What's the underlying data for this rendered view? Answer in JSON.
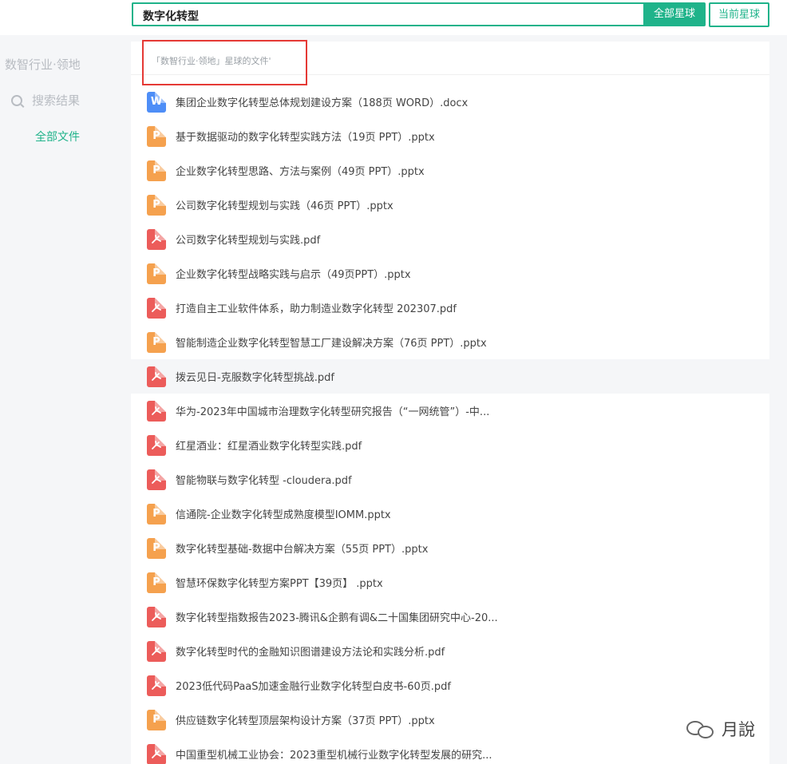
{
  "search": {
    "query": "数字化转型",
    "all_planets_label": "全部星球",
    "current_planet_label": "当前星球"
  },
  "sidebar": {
    "title": "数智行业·领地",
    "search_results_label": "搜索结果",
    "all_files_label": "全部文件"
  },
  "panel": {
    "title": "「数智行业·领地」星球的文件'"
  },
  "files": [
    {
      "type": "word",
      "icon_label": "W",
      "name": "集团企业数字化转型总体规划建设方案（188页 WORD）.docx"
    },
    {
      "type": "ppt",
      "icon_label": "P",
      "name": "基于数据驱动的数字化转型实践方法（19页 PPT）.pptx"
    },
    {
      "type": "ppt",
      "icon_label": "P",
      "name": "企业数字化转型思路、方法与案例（49页 PPT）.pptx"
    },
    {
      "type": "ppt",
      "icon_label": "P",
      "name": "公司数字化转型规划与实践（46页 PPT）.pptx"
    },
    {
      "type": "pdf",
      "icon_label": "",
      "name": "公司数字化转型规划与实践.pdf"
    },
    {
      "type": "ppt",
      "icon_label": "P",
      "name": "企业数字化转型战略实践与启示（49页PPT）.pptx"
    },
    {
      "type": "pdf",
      "icon_label": "",
      "name": "打造自主工业软件体系，助力制造业数字化转型 202307.pdf"
    },
    {
      "type": "ppt",
      "icon_label": "P",
      "name": "智能制造企业数字化转型智慧工厂建设解决方案（76页 PPT）.pptx"
    },
    {
      "type": "pdf",
      "icon_label": "",
      "name": "拨云见日-克服数字化转型挑战.pdf"
    },
    {
      "type": "pdf",
      "icon_label": "",
      "name": "华为-2023年中国城市治理数字化转型研究报告（“一网统管”）-中..."
    },
    {
      "type": "pdf",
      "icon_label": "",
      "name": "红星酒业：红星酒业数字化转型实践.pdf"
    },
    {
      "type": "pdf",
      "icon_label": "",
      "name": "智能物联与数字化转型 -cloudera.pdf"
    },
    {
      "type": "ppt",
      "icon_label": "P",
      "name": "信通院-企业数字化转型成熟度模型IOMM.pptx"
    },
    {
      "type": "ppt",
      "icon_label": "P",
      "name": "数字化转型基础-数据中台解决方案（55页 PPT）.pptx"
    },
    {
      "type": "ppt",
      "icon_label": "P",
      "name": "智慧环保数字化转型方案PPT【39页】 .pptx"
    },
    {
      "type": "pdf",
      "icon_label": "",
      "name": "数字化转型指数报告2023-腾讯&企鹅有调&二十国集团研究中心-20..."
    },
    {
      "type": "pdf",
      "icon_label": "",
      "name": "数字化转型时代的金融知识图谱建设方法论和实践分析.pdf"
    },
    {
      "type": "pdf",
      "icon_label": "",
      "name": "2023低代码PaaS加速金融行业数字化转型白皮书-60页.pdf"
    },
    {
      "type": "ppt",
      "icon_label": "P",
      "name": "供应链数字化转型顶层架构设计方案（37页 PPT）.pptx"
    },
    {
      "type": "pdf",
      "icon_label": "",
      "name": "中国重型机械工业协会：2023重型机械行业数字化转型发展的研究..."
    }
  ],
  "watermark": {
    "text": "月說",
    "icon": "wechat-icon"
  },
  "colors": {
    "accent": "#1fb38a",
    "highlight_border": "#e53935",
    "word_icon": "#4e8ef7",
    "ppt_icon": "#f5a14e",
    "pdf_icon": "#ec5c5a"
  }
}
